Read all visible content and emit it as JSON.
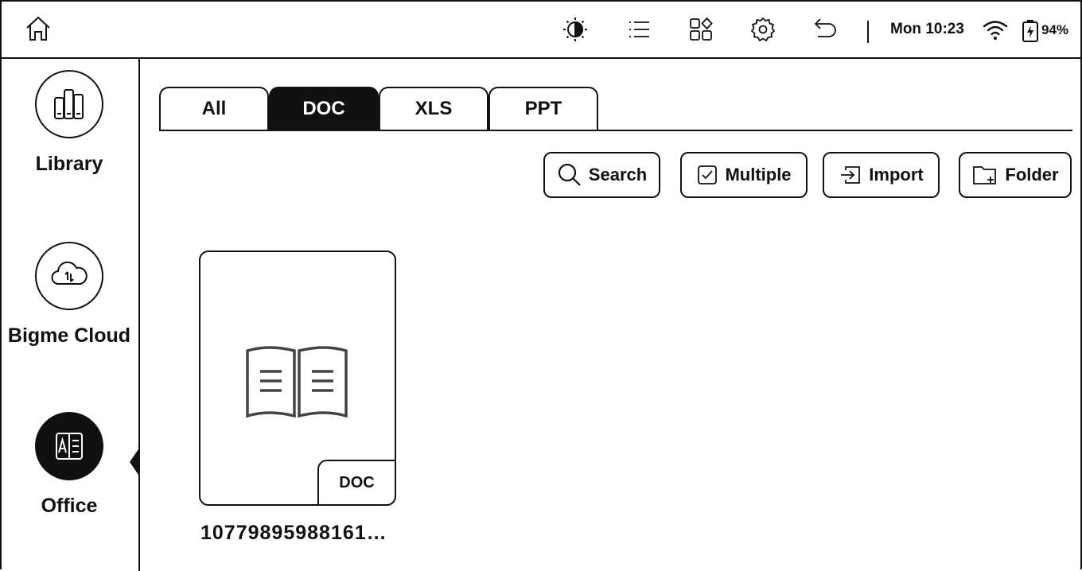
{
  "status_bar": {
    "icons": [
      "home-icon",
      "contrast-icon",
      "list-icon",
      "apps-icon",
      "settings-icon",
      "back-icon",
      "wifi-icon",
      "battery-icon"
    ],
    "time": "Mon 10:23",
    "battery": "94%"
  },
  "sidebar": {
    "items": [
      {
        "label": "Library",
        "icon": "library-icon",
        "active": false
      },
      {
        "label": "Bigme Cloud",
        "icon": "cloud-icon",
        "active": false
      },
      {
        "label": "Office",
        "icon": "office-icon",
        "active": true
      }
    ]
  },
  "tabs": [
    {
      "label": "All",
      "active": false
    },
    {
      "label": "DOC",
      "active": true
    },
    {
      "label": "XLS",
      "active": false
    },
    {
      "label": "PPT",
      "active": false
    }
  ],
  "toolbar": {
    "search_label": "Search",
    "multiple_label": "Multiple",
    "import_label": "Import",
    "folder_label": "Folder"
  },
  "files": [
    {
      "name": "10779895988161…",
      "type": "DOC",
      "icon": "open-book-icon"
    }
  ],
  "colors": {
    "ink": "#111111",
    "paper": "#ffffff"
  }
}
